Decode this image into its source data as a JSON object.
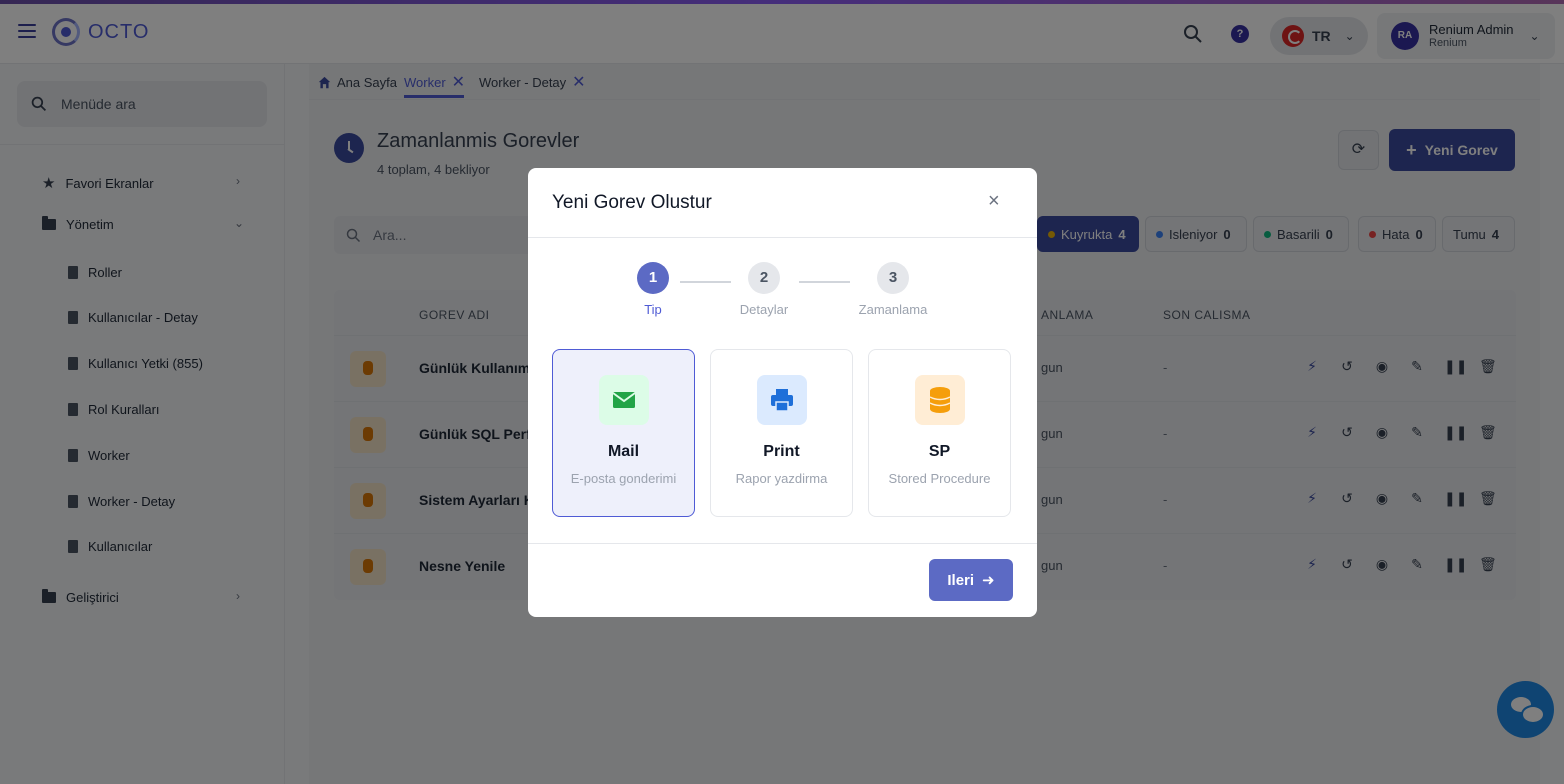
{
  "app": {
    "name": "OCTO"
  },
  "header": {
    "language": "TR",
    "user": {
      "initials": "RA",
      "name": "Renium Admin",
      "org": "Renium"
    }
  },
  "sidebar": {
    "search_placeholder": "Menüde ara",
    "groups": [
      {
        "label": "Favori Ekranlar",
        "expanded": false
      },
      {
        "label": "Yönetim",
        "expanded": true,
        "items": [
          "Roller",
          "Kullanıcılar - Detay",
          "Kullanıcı Yetki (855)",
          "Rol Kuralları",
          "Worker",
          "Worker - Detay",
          "Kullanıcılar"
        ]
      },
      {
        "label": "Geliştirici",
        "expanded": false
      }
    ]
  },
  "tabs": [
    {
      "label": "Ana Sayfa",
      "active": false
    },
    {
      "label": "Worker",
      "active": true
    },
    {
      "label": "Worker - Detay",
      "active": false
    }
  ],
  "page": {
    "title": "Zamanlanmis Gorevler",
    "subtitle": "4 toplam, 4 bekliyor",
    "new_button": "Yeni Gorev",
    "search_placeholder": "Ara..."
  },
  "filters": [
    {
      "label": "Kuyrukta",
      "count": "4",
      "color": "#eab308",
      "active": true
    },
    {
      "label": "Isleniyor",
      "count": "0",
      "color": "#3b82f6",
      "active": false
    },
    {
      "label": "Basarili",
      "count": "0",
      "color": "#10b981",
      "active": false
    },
    {
      "label": "Hata",
      "count": "0",
      "color": "#ef4444",
      "active": false
    },
    {
      "label": "Tumu",
      "count": "4",
      "active": false
    }
  ],
  "table": {
    "columns": [
      "GOREV ADI",
      "ANLAMA",
      "SON CALISMA"
    ],
    "rows": [
      {
        "name": "Günlük Kullanım",
        "plan": "gun",
        "last": "-"
      },
      {
        "name": "Günlük SQL Perfo",
        "plan": "gun",
        "last": "-"
      },
      {
        "name": "Sistem Ayarları K",
        "plan": "gun",
        "last": "-"
      },
      {
        "name": "Nesne Yenile",
        "plan": "gun",
        "last": "-"
      }
    ]
  },
  "modal": {
    "title": "Yeni Gorev Olustur",
    "steps": [
      {
        "num": "1",
        "label": "Tip",
        "active": true
      },
      {
        "num": "2",
        "label": "Detaylar",
        "active": false
      },
      {
        "num": "3",
        "label": "Zamanlama",
        "active": false
      }
    ],
    "types": [
      {
        "title": "Mail",
        "subtitle": "E-posta gonderimi",
        "icon": "envelope-icon",
        "selected": true
      },
      {
        "title": "Print",
        "subtitle": "Rapor yazdirma",
        "icon": "printer-icon",
        "selected": false
      },
      {
        "title": "SP",
        "subtitle": "Stored Procedure",
        "icon": "database-icon",
        "selected": false
      }
    ],
    "next_button": "Ileri"
  }
}
